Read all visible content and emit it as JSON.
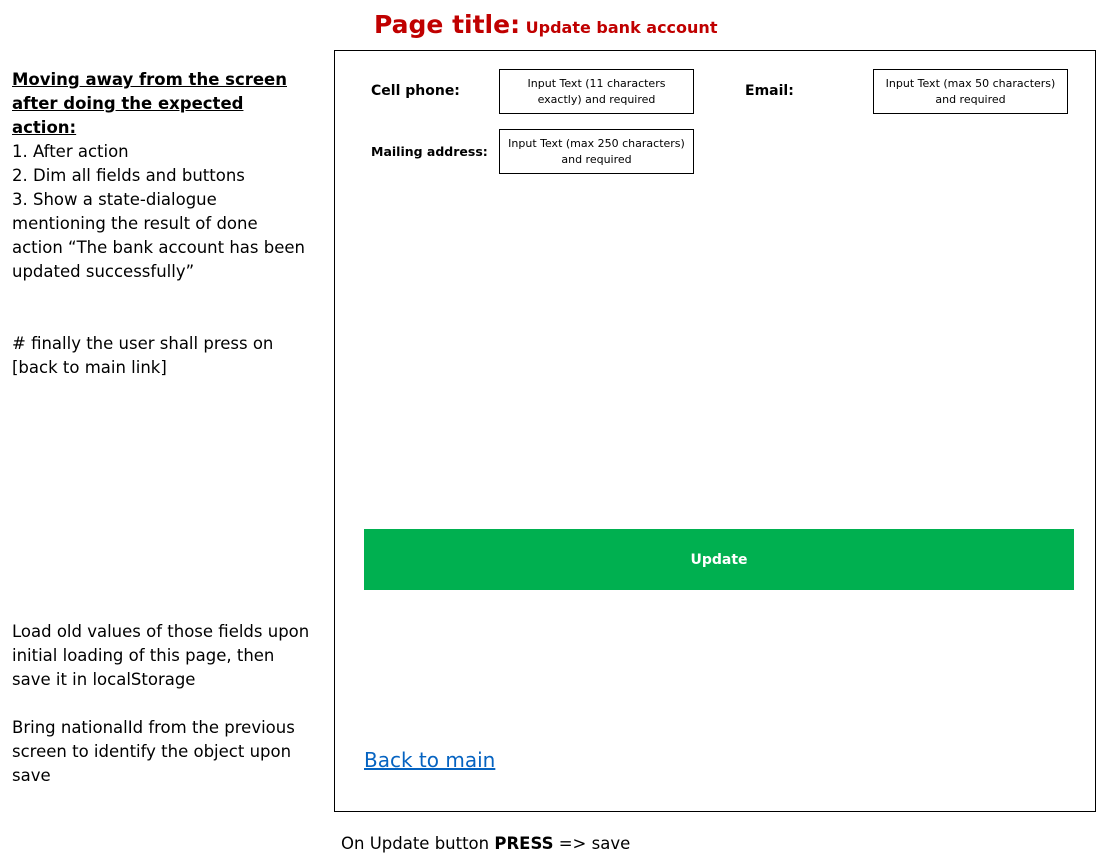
{
  "page_title": {
    "prefix": "Page title:",
    "value": "Update bank account"
  },
  "notes": {
    "heading": "Moving away from the screen after doing the expected action:",
    "steps": [
      "1. After action",
      "2. Dim all fields and buttons",
      "3. Show a state-dialogue mentioning the result of done action “The bank account has been updated successfully”"
    ],
    "final_note": "# finally the user shall press on [back to main link]"
  },
  "notes_bottom": {
    "load_note": "Load old values of those fields upon initial loading of this page, then save it in localStorage",
    "national_note": "Bring nationalId from the previous screen to identify the object upon save"
  },
  "form": {
    "cell_phone": {
      "label": "Cell phone:",
      "hint": "Input Text (11 characters exactly) and required"
    },
    "email": {
      "label": "Email:",
      "hint": "Input Text (max 50 characters) and required"
    },
    "mailing_address": {
      "label": "Mailing address:",
      "hint": "Input Text (max 250 characters) and required"
    },
    "update_label": "Update",
    "back_label": "Back to main"
  },
  "footer": {
    "prefix": "On Update button",
    "emphasis": "PRESS",
    "suffix": "=> save"
  },
  "colors": {
    "title": "#c00000",
    "update_button": "#00b050",
    "link": "#0563c1"
  }
}
